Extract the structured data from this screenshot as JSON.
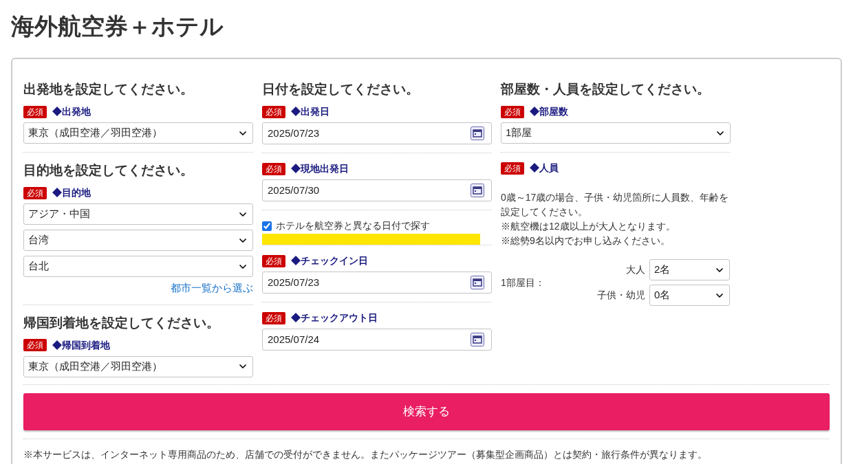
{
  "page_title": "海外航空券＋ホテル",
  "columns": [
    {
      "sections": [
        {
          "heading": "出発地を設定してください。",
          "fields": [
            {
              "kind": "select",
              "required_badge": "必須",
              "label": "◆出発地",
              "selects": [
                "東京（成田空港／羽田空港）"
              ]
            }
          ]
        },
        {
          "heading": "目的地を設定してください。",
          "fields": [
            {
              "kind": "select",
              "required_badge": "必須",
              "label": "◆目的地",
              "selects": [
                "アジア・中国",
                "台湾",
                "台北"
              ],
              "link": "都市一覧から選ぶ"
            }
          ]
        },
        {
          "heading": "帰国到着地を設定してください。",
          "fields": [
            {
              "kind": "select",
              "required_badge": "必須",
              "label": "◆帰国到着地",
              "selects": [
                "東京（成田空港／羽田空港）"
              ]
            }
          ]
        }
      ]
    },
    {
      "sections": [
        {
          "heading": "日付を設定してください。",
          "fields": [
            {
              "kind": "date",
              "required_badge": "必須",
              "label": "◆出発日",
              "value": "2025/07/23"
            },
            {
              "kind": "date",
              "required_badge": "必須",
              "label": "◆現地出発日",
              "value": "2025/07/30"
            },
            {
              "kind": "checkbox",
              "label": "ホテルを航空券と異なる日付で探す",
              "checked": true,
              "highlighted": true
            },
            {
              "kind": "date",
              "required_badge": "必須",
              "label": "◆チェックイン日",
              "value": "2025/07/23"
            },
            {
              "kind": "date",
              "required_badge": "必須",
              "label": "◆チェックアウト日",
              "value": "2025/07/24"
            }
          ]
        }
      ]
    },
    {
      "sections": [
        {
          "heading": "部屋数・人員を設定してください。",
          "fields": [
            {
              "kind": "select",
              "required_badge": "必須",
              "label": "◆部屋数",
              "selects": [
                "1部屋"
              ]
            },
            {
              "kind": "people",
              "required_badge": "必須",
              "label": "◆人員",
              "notes": [
                "0歳～17歳の場合、子供・幼児箇所に人員数、年齢を設定してください。",
                "※航空機は12歳以上が大人となります。",
                "※総勢9名以内でお申し込みください。"
              ],
              "room_label": "1部屋目：",
              "counts": [
                {
                  "label": "大人",
                  "value": "2名"
                },
                {
                  "label": "子供・幼児",
                  "value": "0名"
                }
              ]
            }
          ]
        }
      ]
    }
  ],
  "search_button": "検索する",
  "footer_note": "※本サービスは、インターネット専用商品のため、店舗での受付ができません。またパッケージツアー（募集型企画商品）とは契約・旅行条件が異なります。"
}
